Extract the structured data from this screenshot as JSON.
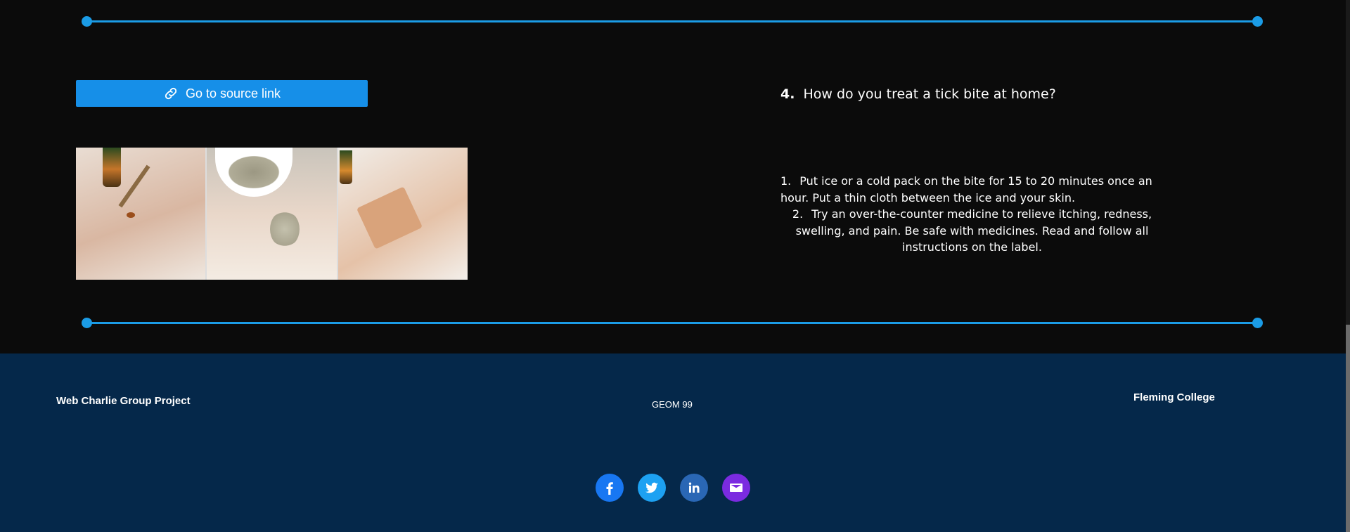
{
  "source_button": {
    "label": "Go to source link",
    "icon": "link-icon"
  },
  "question": {
    "number": "4.",
    "title": "How do you treat a tick bite at home?"
  },
  "answer": {
    "items": [
      {
        "num": "1.",
        "text": "Put ice or a cold pack on the bite for 15 to 20 minutes once an hour. Put a thin cloth between the ice and your skin."
      },
      {
        "num": "2.",
        "text": "Try an over-the-counter medicine to relieve itching, redness, swelling, and pain. Be safe with medicines. Read and follow all instructions on the label."
      }
    ]
  },
  "gallery": {
    "images": [
      "dropper-oil-on-arm",
      "clay-paste-on-arm",
      "bandage-on-arm"
    ]
  },
  "footer": {
    "left": "Web Charlie Group Project",
    "center": "GEOM 99",
    "right": "Fleming College",
    "socials": [
      "facebook-icon",
      "twitter-icon",
      "linkedin-icon",
      "email-icon"
    ]
  },
  "colors": {
    "background": "#0b0b0b",
    "accent": "#1b9ce6",
    "button": "#168fe8",
    "footer": "#05284a"
  }
}
